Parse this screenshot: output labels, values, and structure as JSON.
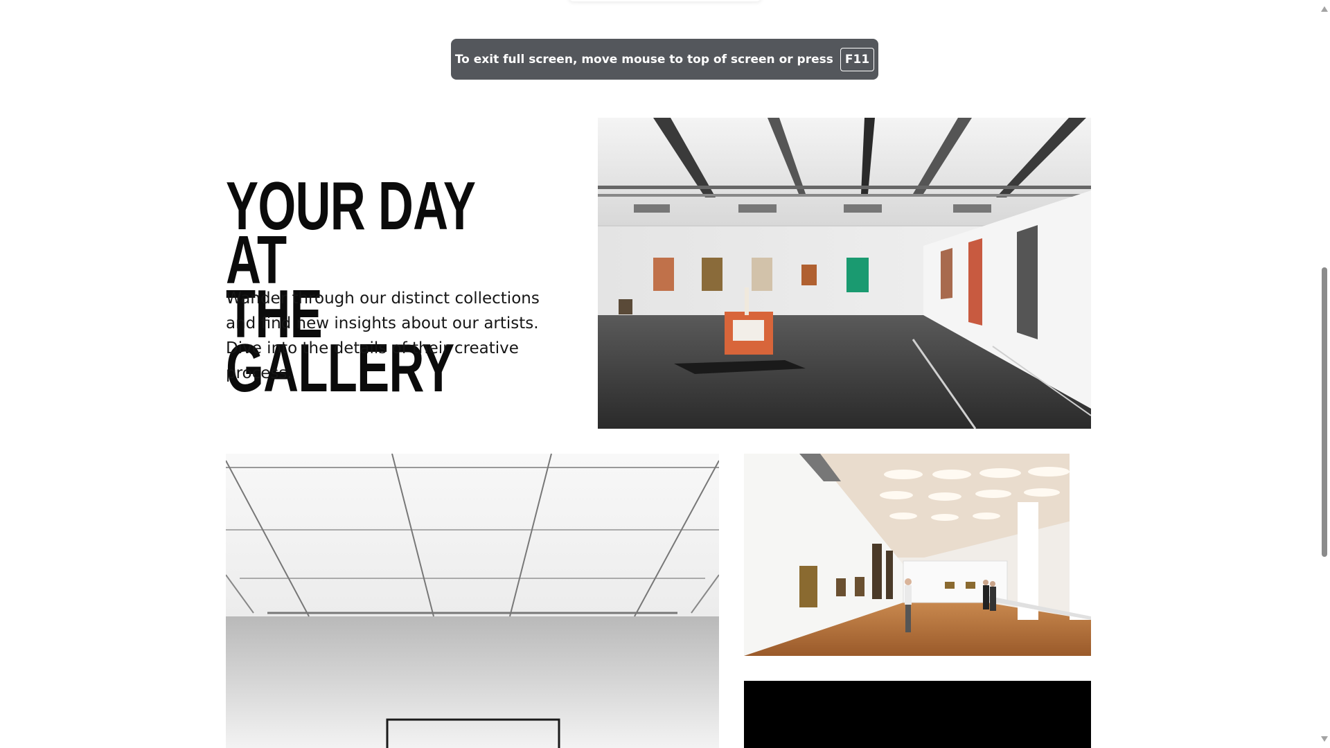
{
  "fullscreen_notice": {
    "text": "To exit full screen, move mouse to top of screen or press",
    "key": "F11"
  },
  "hero": {
    "title": "YOUR DAY AT\nTHE GALLERY",
    "description": "Wander through our distinct collections and find new insights about our artists. Dive into the details of their creative process."
  },
  "images": [
    {
      "name": "gallery-exhibition-photo"
    },
    {
      "name": "gallery-ceiling-photo"
    },
    {
      "name": "gallery-hall-visitors-photo"
    },
    {
      "name": "gallery-dark-photo"
    }
  ],
  "colors": {
    "toast_bg": "#54575c",
    "title": "#0b0b0b",
    "text": "#161616",
    "scroll_thumb": "#8b8b8b"
  }
}
